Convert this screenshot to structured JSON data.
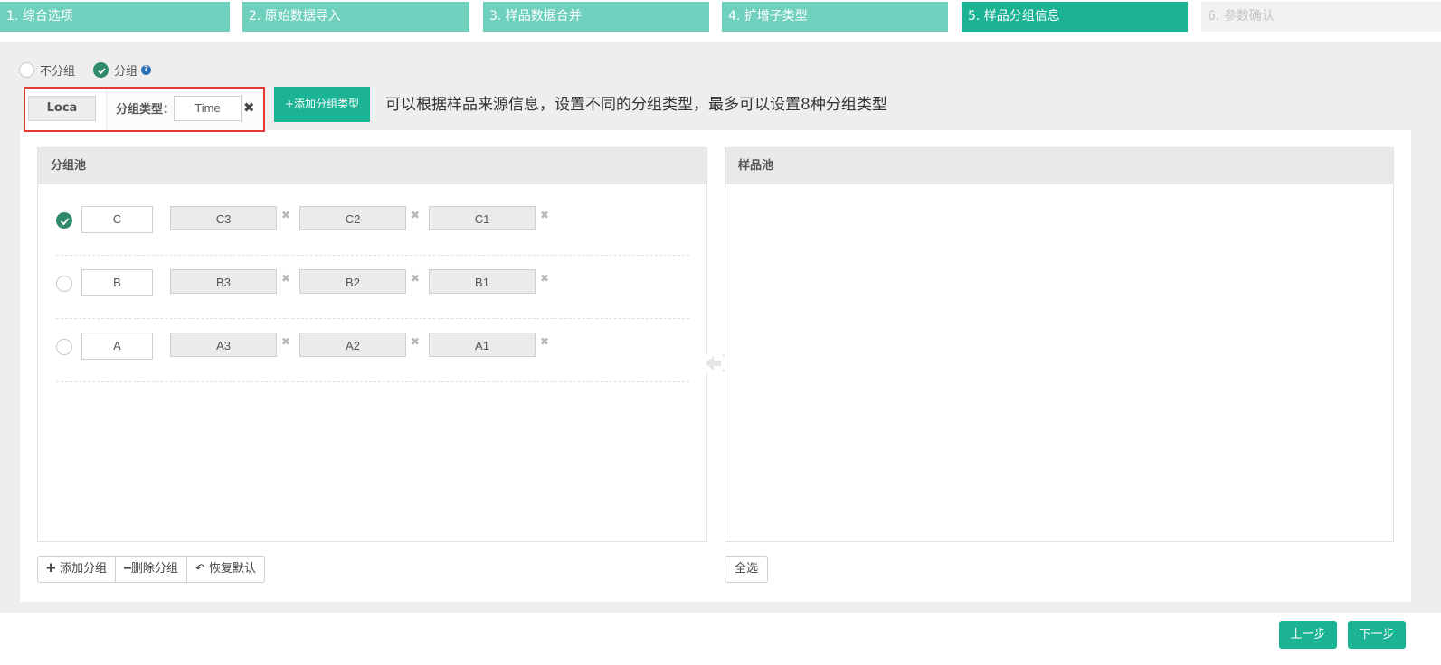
{
  "steps": [
    {
      "label": "1. 综合选项",
      "state": "done"
    },
    {
      "label": "2. 原始数据导入",
      "state": "done"
    },
    {
      "label": "3. 样品数据合并",
      "state": "done"
    },
    {
      "label": "4. 扩增子类型",
      "state": "done"
    },
    {
      "label": "5. 样品分组信息",
      "state": "active"
    },
    {
      "label": "6. 参数确认",
      "state": "todo"
    }
  ],
  "grouping": {
    "no_group_label": "不分组",
    "group_label": "分组",
    "selected": "分组",
    "help_icon": "question-circle-icon"
  },
  "group_type_tabs": {
    "tab_label": "Loca",
    "type_label": "分组类型：",
    "type_value": "Time",
    "close_icon": "close-icon"
  },
  "add_type_button": "+添加分组类型",
  "hint": "可以根据样品来源信息，设置不同的分组类型，最多可以设置8种分组类型",
  "group_pool": {
    "title": "分组池",
    "rows": [
      {
        "name": "C",
        "selected": true,
        "samples": [
          "C3",
          "C2",
          "C1"
        ]
      },
      {
        "name": "B",
        "selected": false,
        "samples": [
          "B3",
          "B2",
          "B1"
        ]
      },
      {
        "name": "A",
        "selected": false,
        "samples": [
          "A3",
          "A2",
          "A1"
        ]
      }
    ]
  },
  "sample_pool": {
    "title": "样品池"
  },
  "buttons": {
    "add_group": "添加分组",
    "delete_group": "删除分组",
    "restore_default": "恢复默认",
    "select_all": "全选",
    "prev": "上一步",
    "next": "下一步"
  },
  "colors": {
    "accent": "#1bb394",
    "step_done": "#6fd0bd",
    "check": "#2e8a6b",
    "highlight_border": "#e53935"
  }
}
